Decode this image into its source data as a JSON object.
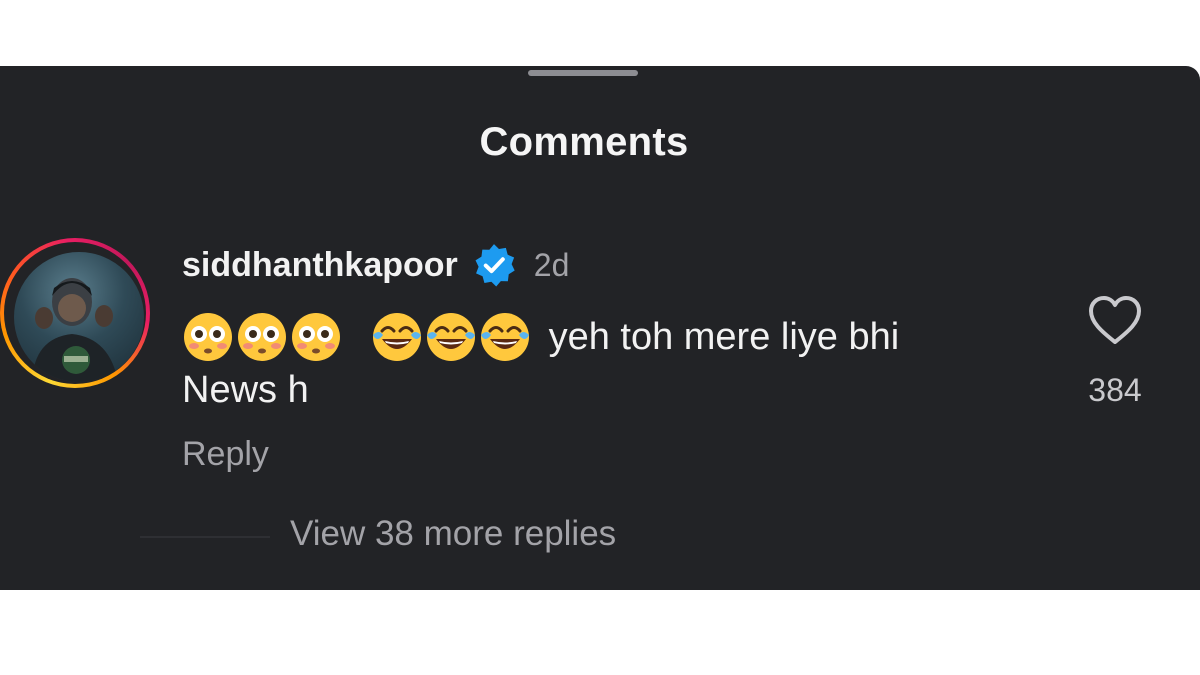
{
  "sheet": {
    "title": "Comments"
  },
  "comment": {
    "username": "siddhanthkapoor",
    "verified": true,
    "time": "2d",
    "emojis_flushed": [
      "flushed-face-emoji",
      "flushed-face-emoji",
      "flushed-face-emoji"
    ],
    "emojis_laughing": [
      "tears-of-joy-emoji",
      "tears-of-joy-emoji",
      "tears-of-joy-emoji"
    ],
    "text": "yeh toh  mere liye bhi News h",
    "reply_label": "Reply",
    "like_count": "384",
    "view_more_label": "View 38 more replies"
  },
  "colors": {
    "background": "#222326",
    "verified_badge": "#1d9bf0",
    "text_primary": "#f2f2f2",
    "text_secondary": "#a3a3a8"
  }
}
